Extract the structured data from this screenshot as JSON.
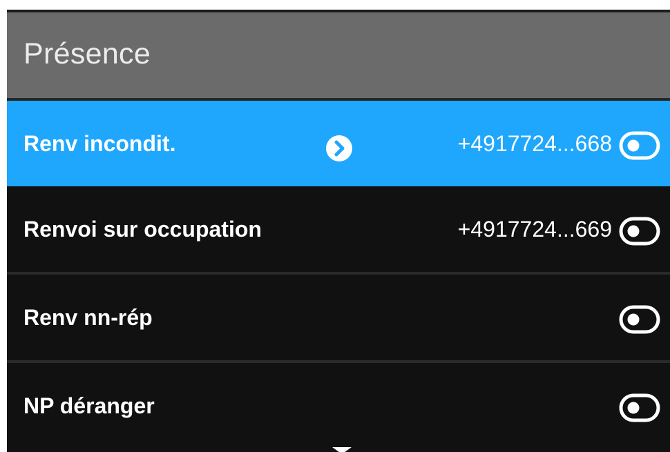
{
  "header": {
    "title": "Présence"
  },
  "items": [
    {
      "label": "Renv incondit.",
      "value": "+4917724...668",
      "selected": true,
      "has_arrow": true,
      "toggle_icon": "toggle-off-icon"
    },
    {
      "label": "Renvoi sur occupation",
      "value": "+4917724...669",
      "selected": false,
      "has_arrow": false,
      "toggle_icon": "toggle-off-icon"
    },
    {
      "label": "Renv nn-rép",
      "value": "",
      "selected": false,
      "has_arrow": false,
      "toggle_icon": "toggle-off-icon"
    },
    {
      "label": "NP déranger",
      "value": "",
      "selected": false,
      "has_arrow": false,
      "toggle_icon": "toggle-off-icon"
    }
  ],
  "icons": {
    "arrow": "chevron-right-circle-icon",
    "scroll": "scroll-down-indicator-icon"
  },
  "colors": {
    "header_bg": "#6b6b6b",
    "selected_bg": "#1ea7fd",
    "list_bg": "#111111",
    "text": "#ffffff"
  }
}
